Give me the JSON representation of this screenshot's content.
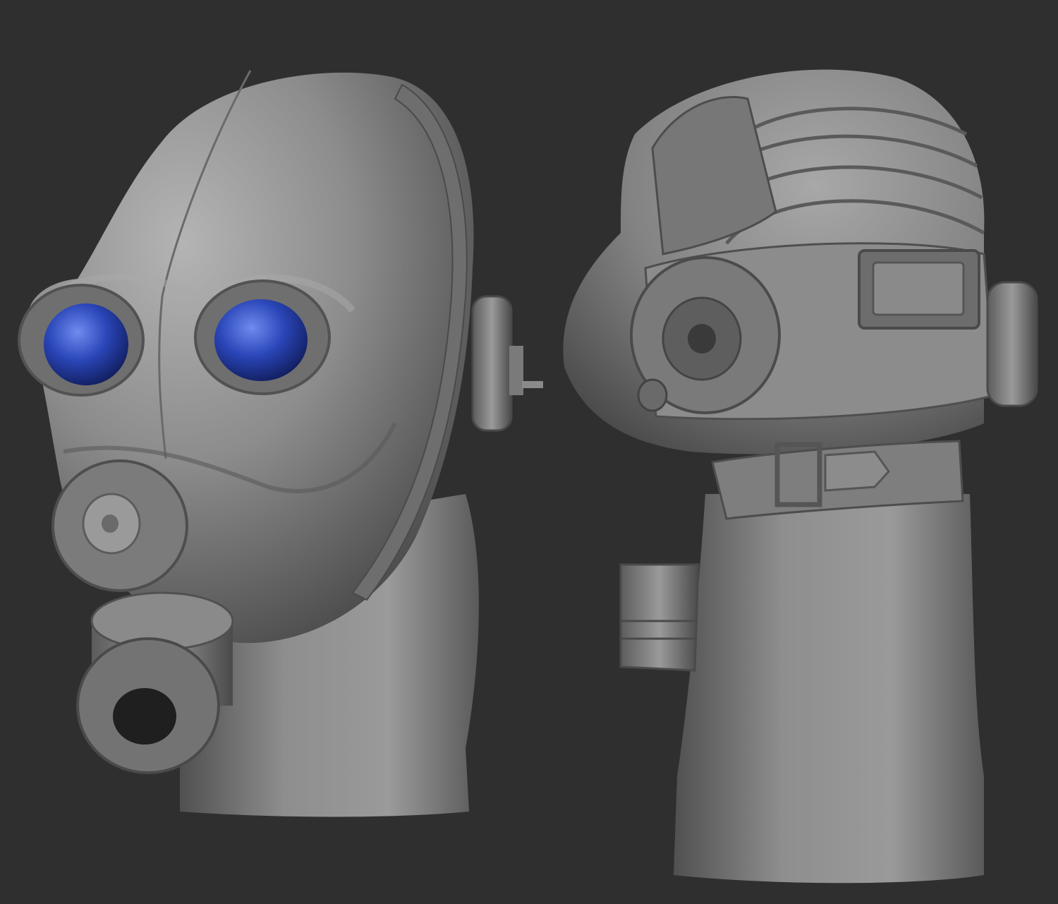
{
  "scene": {
    "background_color": "#2f2f2f",
    "material_color": "#8a8a8a",
    "lens_color": "#2a46b8",
    "views": [
      {
        "name": "front-three-quarter-view"
      },
      {
        "name": "rear-three-quarter-view"
      }
    ]
  }
}
